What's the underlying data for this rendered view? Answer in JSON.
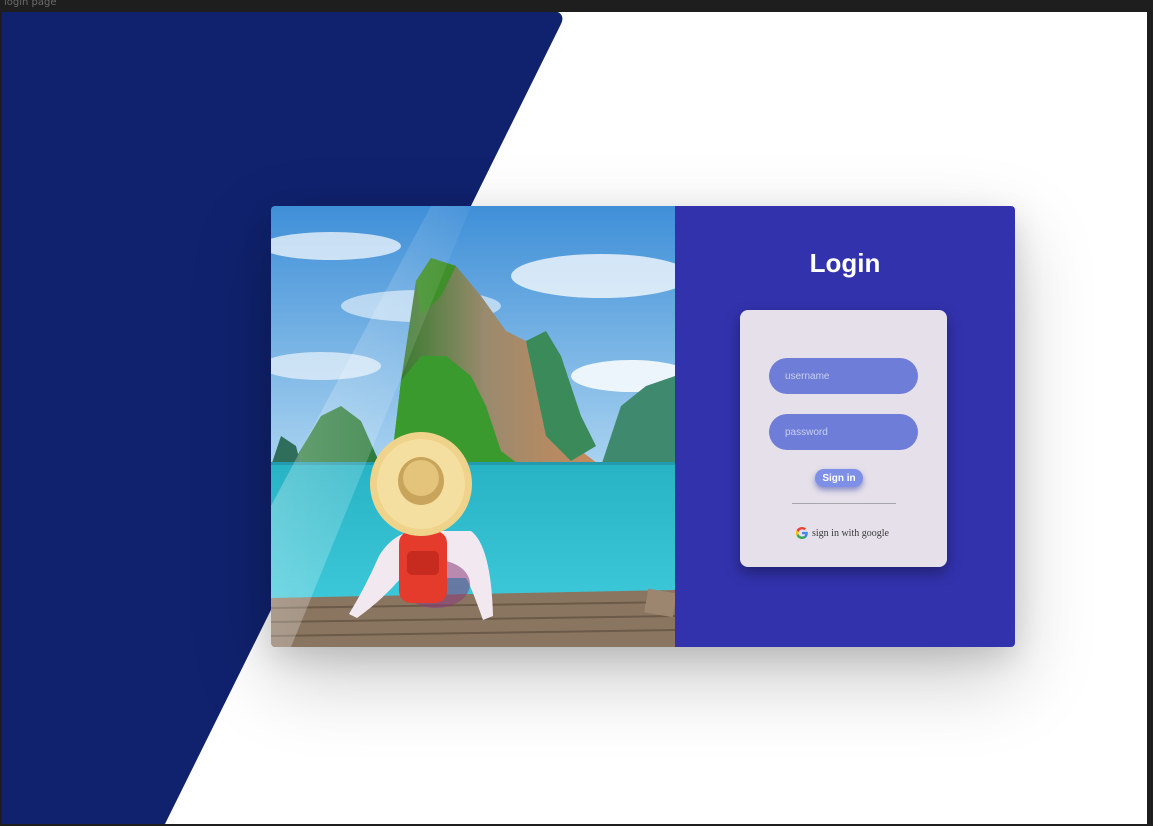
{
  "window": {
    "title": "login page"
  },
  "login": {
    "title": "Login",
    "username_placeholder": "username",
    "password_placeholder": "password",
    "signin_label": "Sign in",
    "google_label": "sign in with google"
  },
  "colors": {
    "navy_background": "#10226e",
    "panel": "#3232ad",
    "form_box": "#e5e0ea",
    "input": "#6e7dd8",
    "button": "#7e8fe8"
  },
  "icons": {
    "google": "google-g-icon"
  }
}
